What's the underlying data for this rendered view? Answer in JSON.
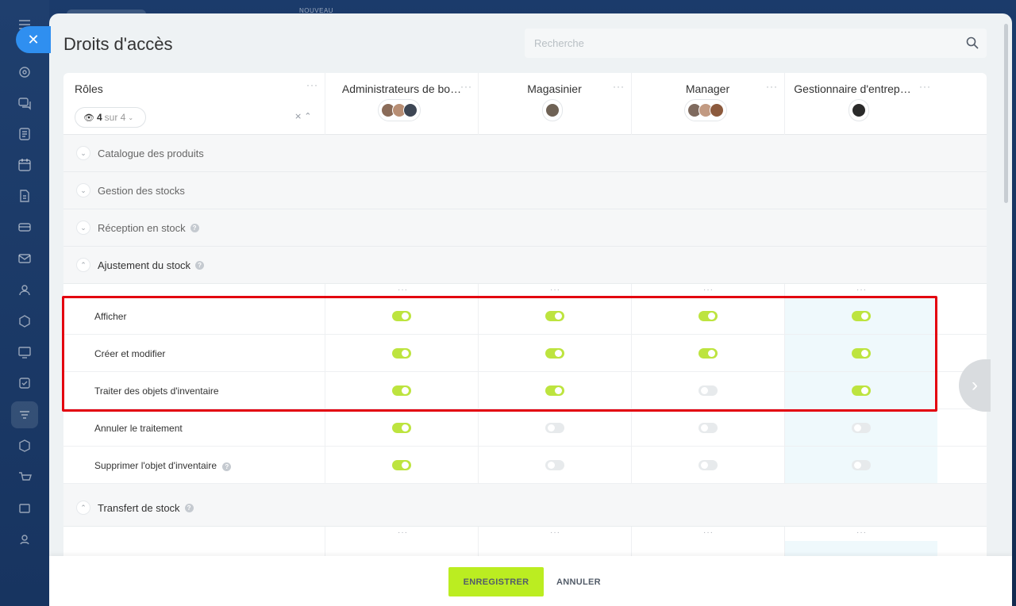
{
  "topbar": {
    "new_badge": "NOUVEAU"
  },
  "panel": {
    "title": "Droits d'accès",
    "search": {
      "placeholder": "Recherche",
      "value": ""
    }
  },
  "roles_header": {
    "label": "Rôles",
    "counter_count": "4",
    "counter_total": "sur 4",
    "roles": [
      {
        "name": "Administrateurs de bo…"
      },
      {
        "name": "Magasinier"
      },
      {
        "name": "Manager"
      },
      {
        "name": "Gestionnaire d'entrep…"
      }
    ]
  },
  "sections": [
    {
      "label": "Catalogue des produits",
      "expanded": false
    },
    {
      "label": "Gestion des stocks",
      "expanded": false
    },
    {
      "label": "Réception en stock",
      "expanded": false
    },
    {
      "label": "Ajustement du stock",
      "expanded": true
    },
    {
      "label": "Transfert de stock",
      "expanded": true
    }
  ],
  "permissions": [
    {
      "label": "Afficher",
      "values": [
        true,
        true,
        true,
        true
      ]
    },
    {
      "label": "Créer et modifier",
      "values": [
        true,
        true,
        true,
        true
      ]
    },
    {
      "label": "Traiter des objets d'inventaire",
      "values": [
        true,
        true,
        false,
        true
      ]
    },
    {
      "label": "Annuler le traitement",
      "values": [
        true,
        false,
        false,
        false
      ]
    },
    {
      "label": "Supprimer l'objet d'inventaire",
      "values": [
        true,
        false,
        false,
        false
      ]
    }
  ],
  "footer": {
    "save_label": "ENREGISTRER",
    "cancel_label": "ANNULER"
  },
  "colors": {
    "accent": "#bbed21",
    "toggle_on": "#bde43f",
    "highlight": "#e3000f",
    "close_button": "#2f8ff0"
  }
}
